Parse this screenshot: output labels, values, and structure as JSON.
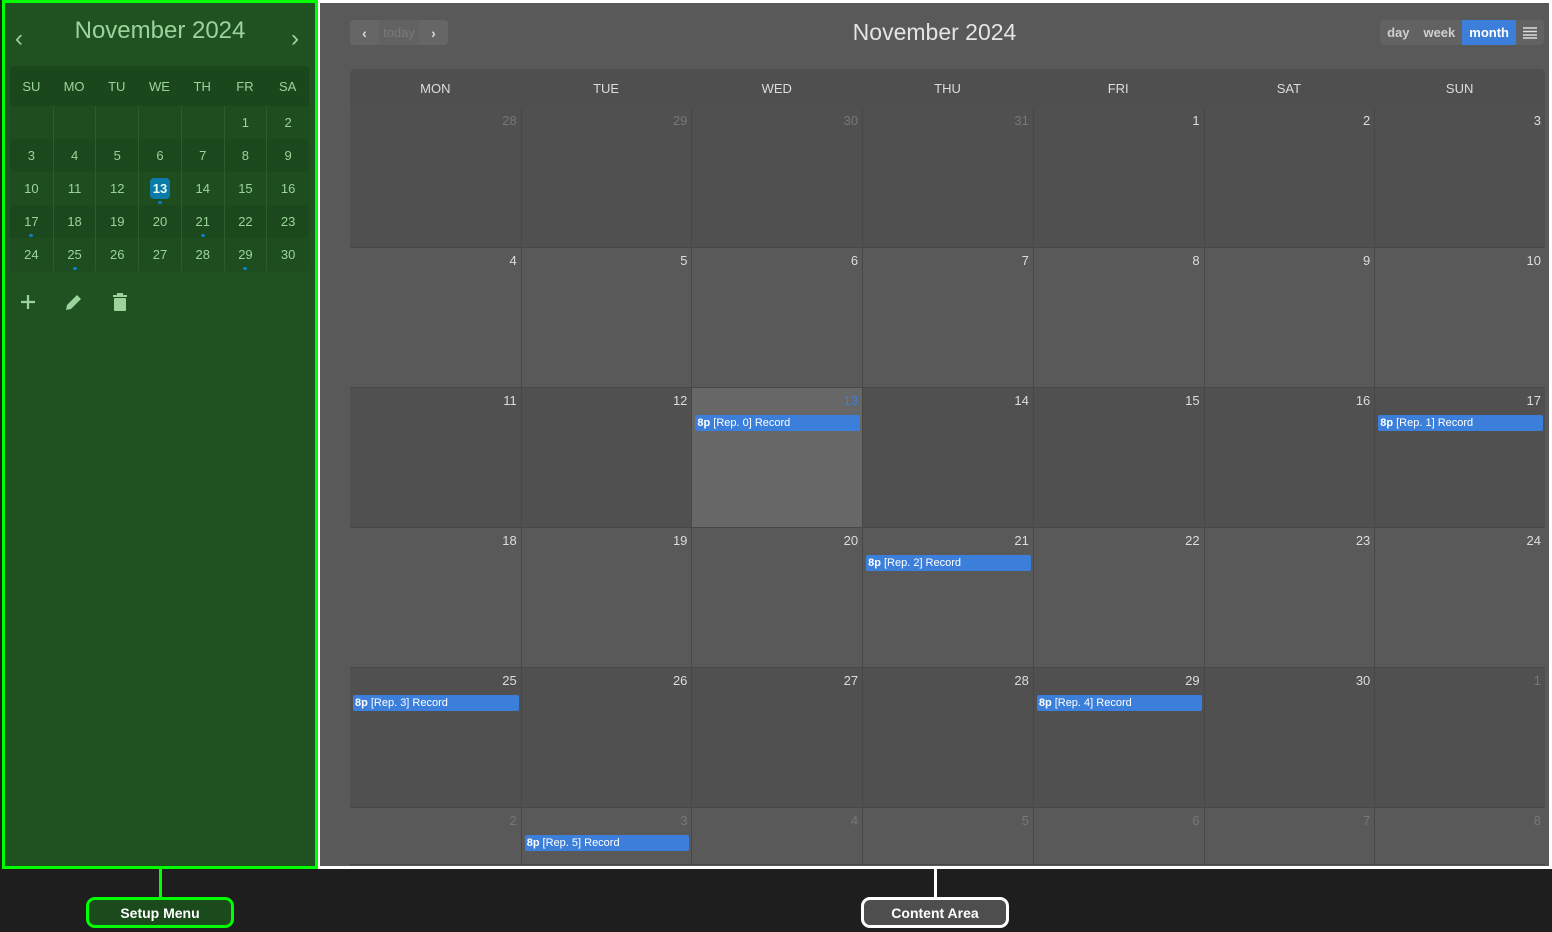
{
  "setup_menu": {
    "month_title": "November 2024",
    "prev": "‹",
    "next": "›",
    "weekdays": [
      "SU",
      "MO",
      "TU",
      "WE",
      "TH",
      "FR",
      "SA"
    ],
    "weeks": [
      [
        {
          "n": ""
        },
        {
          "n": ""
        },
        {
          "n": ""
        },
        {
          "n": ""
        },
        {
          "n": ""
        },
        {
          "n": "1"
        },
        {
          "n": "2"
        }
      ],
      [
        {
          "n": "3"
        },
        {
          "n": "4"
        },
        {
          "n": "5"
        },
        {
          "n": "6"
        },
        {
          "n": "7"
        },
        {
          "n": "8"
        },
        {
          "n": "9"
        }
      ],
      [
        {
          "n": "10"
        },
        {
          "n": "11"
        },
        {
          "n": "12"
        },
        {
          "n": "13",
          "today": true,
          "dot": true
        },
        {
          "n": "14"
        },
        {
          "n": "15"
        },
        {
          "n": "16"
        }
      ],
      [
        {
          "n": "17",
          "dot": true
        },
        {
          "n": "18"
        },
        {
          "n": "19"
        },
        {
          "n": "20"
        },
        {
          "n": "21",
          "dot": true
        },
        {
          "n": "22"
        },
        {
          "n": "23"
        }
      ],
      [
        {
          "n": "24"
        },
        {
          "n": "25",
          "dot": true
        },
        {
          "n": "26"
        },
        {
          "n": "27"
        },
        {
          "n": "28"
        },
        {
          "n": "29",
          "dot": true
        },
        {
          "n": "30"
        }
      ]
    ],
    "tools": [
      {
        "name": "add-icon",
        "glyph": "+"
      },
      {
        "name": "edit-icon"
      },
      {
        "name": "delete-icon"
      }
    ]
  },
  "content": {
    "title": "November 2024",
    "nav": {
      "prev": "‹",
      "today": "today",
      "next": "›"
    },
    "views": [
      {
        "label": "day"
      },
      {
        "label": "week"
      },
      {
        "label": "month",
        "active": true
      }
    ],
    "list_icon": "list-icon",
    "accent": "#3c7fdb",
    "weekdays": [
      "MON",
      "TUE",
      "WED",
      "THU",
      "FRI",
      "SAT",
      "SUN"
    ],
    "weeks": [
      [
        {
          "n": "28",
          "other": true
        },
        {
          "n": "29",
          "other": true
        },
        {
          "n": "30",
          "other": true
        },
        {
          "n": "31",
          "other": true
        },
        {
          "n": "1"
        },
        {
          "n": "2"
        },
        {
          "n": "3"
        }
      ],
      [
        {
          "n": "4"
        },
        {
          "n": "5"
        },
        {
          "n": "6"
        },
        {
          "n": "7"
        },
        {
          "n": "8"
        },
        {
          "n": "9"
        },
        {
          "n": "10"
        }
      ],
      [
        {
          "n": "11"
        },
        {
          "n": "12"
        },
        {
          "n": "13",
          "today": true,
          "event": {
            "time": "8p",
            "title": "[Rep. 0] Record"
          }
        },
        {
          "n": "14"
        },
        {
          "n": "15"
        },
        {
          "n": "16"
        },
        {
          "n": "17",
          "event": {
            "time": "8p",
            "title": "[Rep. 1] Record"
          }
        }
      ],
      [
        {
          "n": "18"
        },
        {
          "n": "19"
        },
        {
          "n": "20"
        },
        {
          "n": "21",
          "event": {
            "time": "8p",
            "title": "[Rep. 2] Record"
          }
        },
        {
          "n": "22"
        },
        {
          "n": "23"
        },
        {
          "n": "24"
        }
      ],
      [
        {
          "n": "25",
          "event": {
            "time": "8p",
            "title": "[Rep. 3] Record"
          }
        },
        {
          "n": "26"
        },
        {
          "n": "27"
        },
        {
          "n": "28"
        },
        {
          "n": "29",
          "event": {
            "time": "8p",
            "title": "[Rep. 4] Record"
          }
        },
        {
          "n": "30"
        },
        {
          "n": "1",
          "other": true
        }
      ],
      [
        {
          "n": "2",
          "other": true
        },
        {
          "n": "3",
          "other": true,
          "event": {
            "time": "8p",
            "title": "[Rep. 5] Record"
          }
        },
        {
          "n": "4",
          "other": true
        },
        {
          "n": "5",
          "other": true
        },
        {
          "n": "6",
          "other": true
        },
        {
          "n": "7",
          "other": true
        },
        {
          "n": "8",
          "other": true
        }
      ]
    ]
  },
  "labels": {
    "setup": "Setup Menu",
    "content": "Content Area"
  }
}
